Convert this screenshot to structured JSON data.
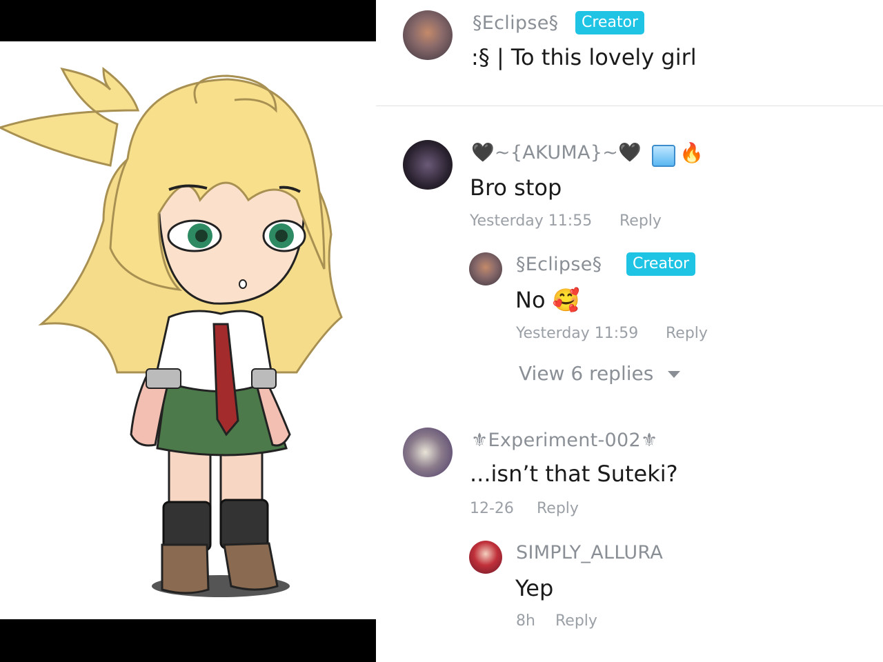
{
  "post": {
    "author": "§Eclipse§",
    "badge": "Creator",
    "caption": ":§ | To this lovely girl"
  },
  "comments": [
    {
      "author": "🖤~{AKUMA}~🖤",
      "text": "Bro stop",
      "time": "Yesterday 11:55",
      "reply_label": "Reply",
      "badges": [
        "ice-cube-icon",
        "fire-icon"
      ],
      "replies": [
        {
          "author": "§Eclipse§",
          "badge": "Creator",
          "text": "No 🥰",
          "time": "Yesterday 11:59",
          "reply_label": "Reply"
        }
      ],
      "view_replies": "View 6 replies"
    },
    {
      "author": "⚜Experiment-002⚜",
      "text": "...isn’t that Suteki?",
      "time": "12-26",
      "reply_label": "Reply",
      "replies": [
        {
          "author": "SIMPLY_ALLURA",
          "text": "Yep",
          "time": "8h",
          "reply_label": "Reply"
        }
      ]
    }
  ],
  "colors": {
    "creator_badge": "#1fc4e4",
    "muted_text": "#9ba0a6",
    "letterbox": "#000000"
  }
}
